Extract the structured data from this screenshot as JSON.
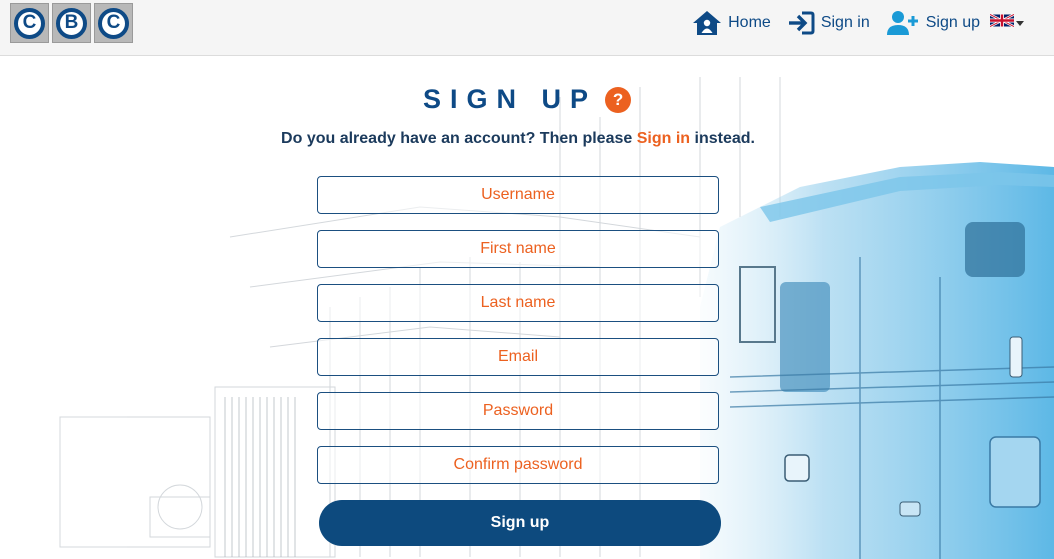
{
  "header": {
    "logo_letters": [
      "C",
      "B",
      "C"
    ],
    "nav": {
      "home": "Home",
      "sign_in": "Sign in",
      "sign_up": "Sign up"
    },
    "language_icon": "uk-flag-icon"
  },
  "main": {
    "title": "SIGN UP",
    "help_symbol": "?",
    "subtitle_before": "Do you already have an account? Then please ",
    "subtitle_link": "Sign in",
    "subtitle_after": " instead.",
    "fields": {
      "username": "Username",
      "first_name": "First name",
      "last_name": "Last name",
      "email": "Email",
      "password": "Password",
      "confirm_password": "Confirm password"
    },
    "submit_label": "Sign up"
  },
  "colors": {
    "brand_blue": "#0e4a86",
    "accent_orange": "#ec6120",
    "button_blue": "#0d4a7e"
  }
}
